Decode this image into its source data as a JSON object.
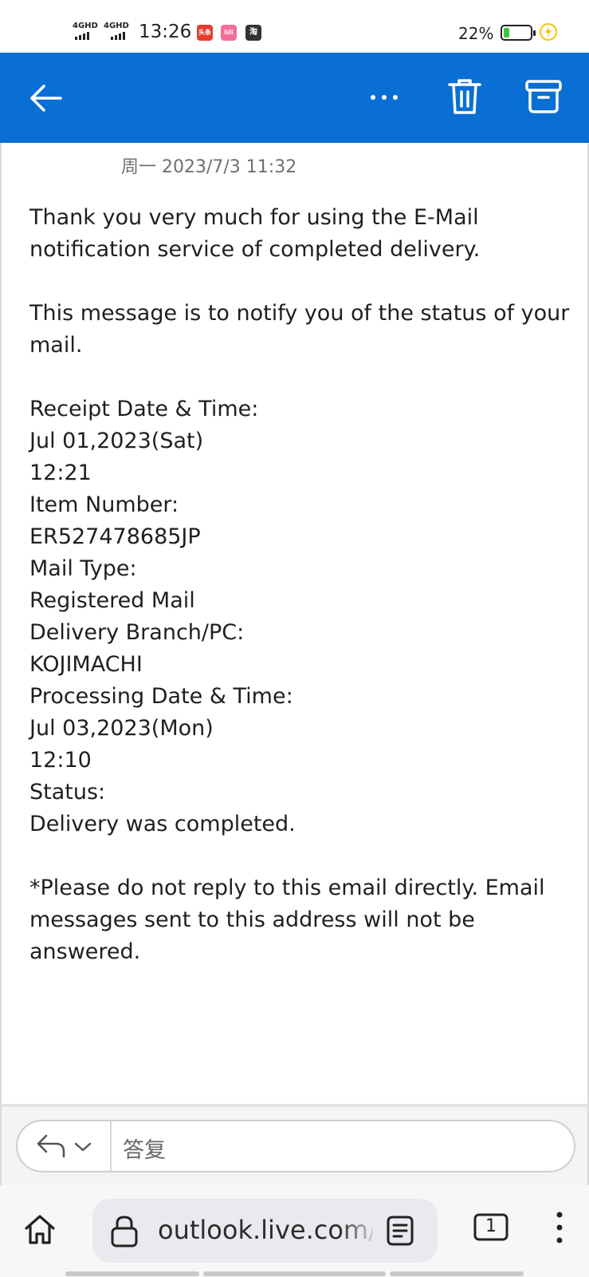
{
  "status_bar": {
    "network_1": "4GHD",
    "network_2": "4GHD",
    "time": "13:26",
    "app_icon_1": "头条",
    "app_icon_2": "bili",
    "app_icon_3": "淘",
    "battery_percent": "22%",
    "battery_level": 0.22,
    "colors": {
      "battery_fill": "#3cc43c",
      "charging": "#f5c400"
    }
  },
  "app_bar": {
    "background": "#0a6fd4",
    "icons": [
      "back-arrow-icon",
      "more-icon",
      "delete-icon",
      "archive-icon"
    ]
  },
  "email": {
    "date": "周一 2023/7/3 11:32",
    "intro": "Thank you very much for using the E-Mail notification service of completed delivery.",
    "notice": "This message is to notify you of the status of your mail.",
    "fields": [
      {
        "label": "Receipt Date & Time:",
        "value_lines": [
          "Jul 01,2023(Sat)",
          "12:21"
        ]
      },
      {
        "label": "Item Number:",
        "value_lines": [
          "ER527478685JP"
        ]
      },
      {
        "label": "Mail Type:",
        "value_lines": [
          "Registered Mail"
        ]
      },
      {
        "label": "Delivery Branch/PC:",
        "value_lines": [
          "KOJIMACHI"
        ]
      },
      {
        "label": "Processing Date & Time:",
        "value_lines": [
          "Jul 03,2023(Mon)",
          "12:10"
        ]
      },
      {
        "label": "Status:",
        "value_lines": [
          "Delivery was completed."
        ]
      }
    ],
    "footer": "*Please do not reply to this email directly. Email messages sent to this address will not be answered."
  },
  "reply": {
    "placeholder": "答复",
    "icons": [
      "reply-icon",
      "chevron-down-icon"
    ]
  },
  "browser": {
    "url": "outlook.live.com/mail",
    "tab_count": "1",
    "icons": [
      "home-icon",
      "lock-icon",
      "reader-mode-icon",
      "tabs-icon",
      "menu-icon"
    ]
  }
}
